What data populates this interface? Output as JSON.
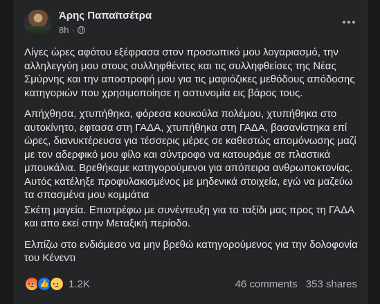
{
  "post": {
    "author": "Άρης Παπαϊτσέτρα",
    "time": "8h",
    "separator": "·",
    "paragraphs": [
      "Λίγες ώρες αφότου εξέφρασα στον προσωπικό μου λογαριασμό, την αλληλεγγύη μου στους συλληφθέντες και τις συλληφθείσες της Νέας Σμύρνης και την αποστροφή μου για τις μαφιόζικες μεθόδους απόδοσης κατηγοριών που χρησιμοποίησε η αστυνομία εις βάρος τους.",
      "Απήχθησα, χτυπήθηκα, φόρεσα κουκούλα πολέμου, χτυπήθηκα στο αυτοκίνητο, εφτασα στη ΓΑΔΑ, χτυπήθηκα στη ΓΑΔΑ, βασανίστηκα επί ώρες, διανυκτέρευσα για τέσσερις μέρες σε καθεστώς απομόνωσης μαζί με τον αδερφικό μου φίλο και σύντροφο να κατουράμε σε πλαστικά μπουκάλια. Βρεθήκαμε κατηγορούμενοι για απόπειρα ανθρωποκτονίας. Αυτός κατέληξε προφυλακισμένος με μηδενικά στοιχεία, εγώ να μαζεύω τα σπασμένα μου κομμάτια",
      "Σκέτη μαγεία. Επιστρέφω με συνέντευξη για το ταξίδι μας προς τη ΓΑΔΑ και απο εκεί στην Μεταξική περίοδο.",
      "Ελπίζω στο ενδιάμεσο να μην βρεθώ κατηγορούμενος για την δολοφονία του Κένεντι"
    ]
  },
  "footer": {
    "reactions": [
      "angry",
      "like",
      "sad"
    ],
    "reaction_count": "1.2K",
    "comments": "46 comments",
    "shares": "353 shares"
  },
  "colors": {
    "background": "#18191a",
    "card": "#242526",
    "text_primary": "#e4e6eb",
    "text_secondary": "#b0b3b8",
    "like_blue": "#1877f2"
  }
}
